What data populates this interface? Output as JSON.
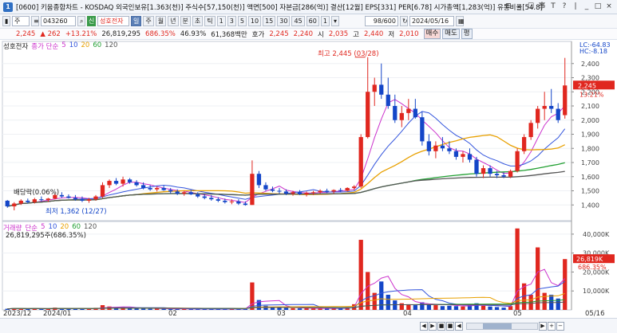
{
  "window": {
    "screen_no": "0600",
    "title": "[0600] 키움종합차트 - KOSDAQ 외국인보유[1.363(천)] 주식수[57,150(천)] 액면[500] 자본금[286(억)] 결산[12월] EPS[331] PER[6.78] 시가총액[1,283(억)] 유통비율[54.8]",
    "buttons": [
      "⊟",
      "⌕",
      "☐",
      "事",
      "T",
      "?",
      "|",
      "_",
      "□",
      "×"
    ]
  },
  "toolbar": {
    "type_label": "주",
    "code": "043260",
    "stock_name": "성호전자",
    "periods": [
      "일",
      "주",
      "월",
      "년",
      "분",
      "초",
      "틱"
    ],
    "active_period": "일",
    "intervals": [
      "1",
      "3",
      "5",
      "10",
      "15",
      "30",
      "45",
      "60",
      "1"
    ],
    "count": "98/600",
    "date": "2024/05/16"
  },
  "quote": {
    "price": "2,245",
    "change": "▲ 262",
    "change_pct": "+13.21%",
    "volume": "26,819,295",
    "vol_pct": "686.35%",
    "turnover": "46.93%",
    "amount": "61,368백만",
    "ask_label": "호가",
    "ask": "2,245",
    "bid": "2,240",
    "open_label": "시",
    "open": "2,035",
    "high_label": "고",
    "high": "2,440",
    "low_label": "저",
    "low": "2,010",
    "buy_label": "매수",
    "sell_label": "매도",
    "avg_label": "평"
  },
  "chart_data": [
    {
      "type": "candlestick",
      "legend": {
        "stock": "성호전자",
        "ma_label": "종가 단순",
        "ma_periods": [
          "5",
          "10",
          "20",
          "60",
          "120"
        ]
      },
      "ma_colors": [
        "#cc33cc",
        "#3355dd",
        "#e8a000",
        "#22a033",
        "#555555"
      ],
      "up_color": "#e0271f",
      "down_color": "#1446c8",
      "ylim": [
        1300,
        2500
      ],
      "y_ticks": [
        1400,
        1500,
        1600,
        1700,
        1800,
        1900,
        2000,
        2100,
        2200,
        2300,
        2400
      ],
      "y_tick_labels": [
        "1,400",
        "1,500",
        "1,600",
        "1,700",
        "1,800",
        "1,900",
        "2,000",
        "2,100",
        "2,200",
        "2,300",
        "2,400"
      ],
      "current_price_label": "2,245",
      "current_pct_label": "13.21%",
      "corner_labels": [
        "LC:-64.83",
        "HC:-8.18"
      ],
      "annotations": {
        "high": "최고 2,445 (03/28)",
        "low": "최저 1,362 (12/27)",
        "dividend": "배당락(0.06%)"
      },
      "ohlc": [
        [
          1430,
          1435,
          1380,
          1390
        ],
        [
          1390,
          1420,
          1362,
          1410
        ],
        [
          1410,
          1440,
          1400,
          1430
        ],
        [
          1430,
          1445,
          1410,
          1420
        ],
        [
          1420,
          1450,
          1410,
          1440
        ],
        [
          1440,
          1460,
          1425,
          1435
        ],
        [
          1435,
          1450,
          1420,
          1445
        ],
        [
          1445,
          1480,
          1440,
          1470
        ],
        [
          1470,
          1490,
          1450,
          1460
        ],
        [
          1460,
          1475,
          1445,
          1450
        ],
        [
          1450,
          1470,
          1430,
          1440
        ],
        [
          1440,
          1460,
          1420,
          1430
        ],
        [
          1430,
          1450,
          1415,
          1440
        ],
        [
          1440,
          1470,
          1430,
          1460
        ],
        [
          1460,
          1560,
          1450,
          1540
        ],
        [
          1540,
          1580,
          1520,
          1570
        ],
        [
          1570,
          1590,
          1540,
          1550
        ],
        [
          1550,
          1600,
          1530,
          1580
        ],
        [
          1580,
          1590,
          1550,
          1560
        ],
        [
          1560,
          1575,
          1530,
          1540
        ],
        [
          1540,
          1560,
          1510,
          1520
        ],
        [
          1520,
          1540,
          1500,
          1510
        ],
        [
          1510,
          1530,
          1495,
          1520
        ],
        [
          1520,
          1535,
          1500,
          1505
        ],
        [
          1505,
          1520,
          1480,
          1495
        ],
        [
          1495,
          1510,
          1470,
          1480
        ],
        [
          1480,
          1500,
          1465,
          1490
        ],
        [
          1490,
          1505,
          1470,
          1475
        ],
        [
          1475,
          1490,
          1450,
          1460
        ],
        [
          1460,
          1475,
          1440,
          1450
        ],
        [
          1450,
          1470,
          1430,
          1440
        ],
        [
          1440,
          1455,
          1420,
          1430
        ],
        [
          1430,
          1445,
          1410,
          1420
        ],
        [
          1420,
          1440,
          1405,
          1425
        ],
        [
          1425,
          1440,
          1400,
          1410
        ],
        [
          1410,
          1425,
          1395,
          1400
        ],
        [
          1400,
          1715,
          1400,
          1620
        ],
        [
          1620,
          1640,
          1520,
          1540
        ],
        [
          1540,
          1560,
          1500,
          1510
        ],
        [
          1510,
          1530,
          1490,
          1500
        ],
        [
          1500,
          1520,
          1480,
          1495
        ],
        [
          1495,
          1510,
          1470,
          1480
        ],
        [
          1480,
          1500,
          1465,
          1490
        ],
        [
          1490,
          1505,
          1470,
          1475
        ],
        [
          1475,
          1495,
          1460,
          1485
        ],
        [
          1485,
          1500,
          1470,
          1490
        ],
        [
          1490,
          1510,
          1480,
          1500
        ],
        [
          1500,
          1515,
          1485,
          1495
        ],
        [
          1495,
          1510,
          1480,
          1505
        ],
        [
          1505,
          1520,
          1490,
          1500
        ],
        [
          1500,
          1525,
          1495,
          1520
        ],
        [
          1520,
          1540,
          1505,
          1530
        ],
        [
          1530,
          1900,
          1520,
          1880
        ],
        [
          1880,
          2445,
          1870,
          2200
        ],
        [
          2200,
          2300,
          2100,
          2250
        ],
        [
          2250,
          2400,
          2150,
          2180
        ],
        [
          2180,
          2300,
          2080,
          2100
        ],
        [
          2100,
          2180,
          1980,
          2000
        ],
        [
          2000,
          2100,
          1950,
          2050
        ],
        [
          2050,
          2150,
          2000,
          2080
        ],
        [
          2080,
          2150,
          2010,
          2020
        ],
        [
          2020,
          2060,
          1820,
          1850
        ],
        [
          1850,
          1900,
          1750,
          1780
        ],
        [
          1780,
          1850,
          1730,
          1820
        ],
        [
          1820,
          1880,
          1780,
          1800
        ],
        [
          1800,
          1850,
          1760,
          1780
        ],
        [
          1780,
          1800,
          1720,
          1740
        ],
        [
          1740,
          1780,
          1700,
          1760
        ],
        [
          1760,
          1800,
          1700,
          1720
        ],
        [
          1720,
          1740,
          1600,
          1620
        ],
        [
          1620,
          1680,
          1590,
          1660
        ],
        [
          1660,
          1680,
          1600,
          1620
        ],
        [
          1620,
          1640,
          1590,
          1610
        ],
        [
          1610,
          1630,
          1590,
          1600
        ],
        [
          1600,
          1650,
          1590,
          1640
        ],
        [
          1640,
          1800,
          1630,
          1780
        ],
        [
          1780,
          1900,
          1760,
          1880
        ],
        [
          1880,
          2000,
          1860,
          1980
        ],
        [
          1980,
          2100,
          1940,
          2080
        ],
        [
          2080,
          2200,
          2000,
          2100
        ],
        [
          2100,
          2220,
          2050,
          2080
        ],
        [
          2080,
          2120,
          1980,
          2000
        ],
        [
          2035,
          2440,
          2010,
          2245
        ]
      ]
    },
    {
      "type": "bar",
      "legend": {
        "label": "거래량",
        "ma_label": "단순",
        "ma_periods": [
          "5",
          "10",
          "20",
          "60",
          "120"
        ]
      },
      "summary": "26,819,295주(686.35%)",
      "ylim": [
        0,
        45000
      ],
      "y_ticks": [
        10000,
        20000,
        30000,
        40000
      ],
      "y_tick_labels": [
        "10,000K",
        "20,000K",
        "30,000K",
        "40,000K"
      ],
      "current_labels": [
        "26,819K",
        "686.35%"
      ],
      "unit": "K",
      "values": [
        600,
        900,
        700,
        500,
        800,
        600,
        500,
        1200,
        900,
        700,
        600,
        500,
        600,
        1100,
        2500,
        1800,
        1200,
        1400,
        900,
        800,
        700,
        600,
        800,
        600,
        500,
        500,
        600,
        500,
        400,
        500,
        600,
        500,
        400,
        600,
        500,
        500,
        14500,
        5200,
        2200,
        1500,
        1200,
        1000,
        900,
        800,
        900,
        800,
        700,
        800,
        900,
        800,
        1500,
        3000,
        37000,
        20000,
        9000,
        15000,
        8000,
        5000,
        3500,
        3000,
        2500,
        4000,
        3000,
        2500,
        2000,
        2200,
        2000,
        1800,
        2500,
        3500,
        2200,
        1800,
        1500,
        1200,
        2000,
        43000,
        14000,
        8000,
        33000,
        9000,
        8000,
        6000,
        26819
      ]
    }
  ],
  "x_axis": {
    "labels": [
      "2023/12",
      "2024/01",
      "02",
      "03",
      "04",
      "05",
      "05/16"
    ]
  },
  "bottombar": {
    "nav_buttons": [
      "◀",
      "▶",
      "■",
      "■",
      "◀",
      "▶",
      "+",
      "−"
    ]
  }
}
